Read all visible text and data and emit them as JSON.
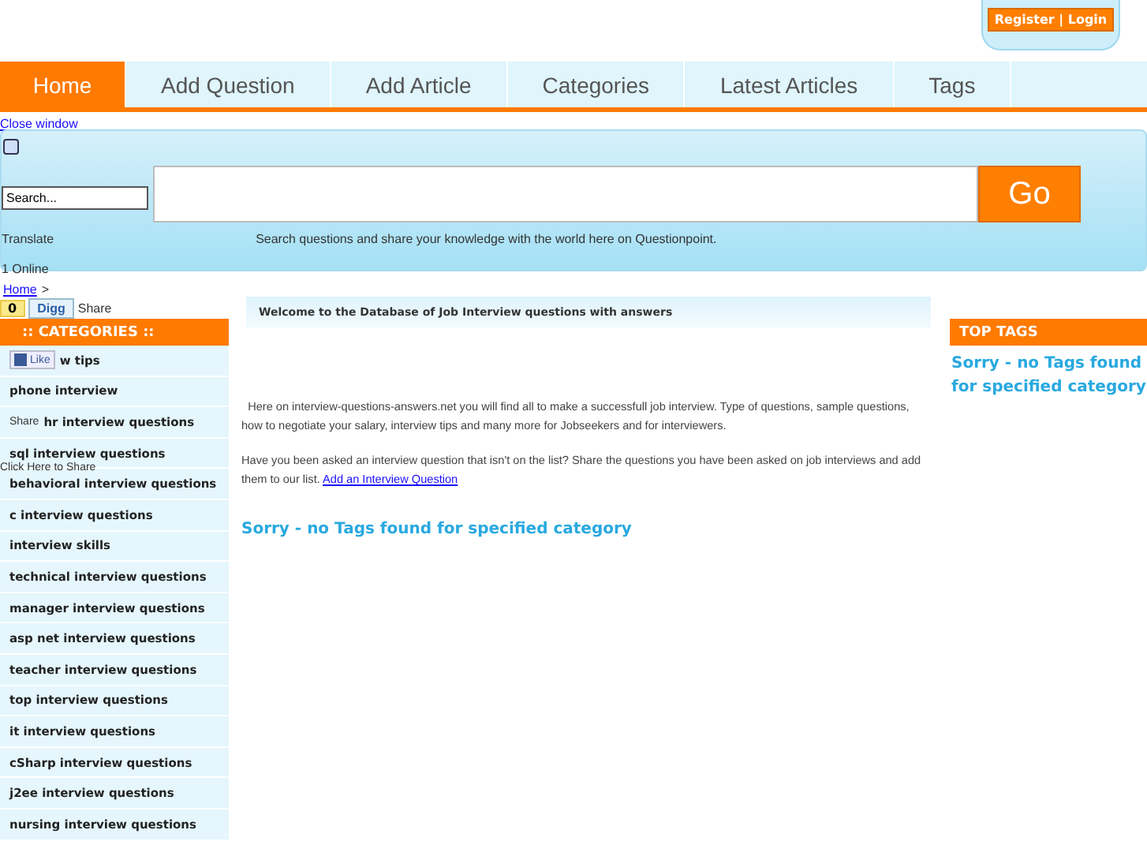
{
  "account": {
    "label": "Register | Login"
  },
  "nav": [
    {
      "label": "Home",
      "selected": true
    },
    {
      "label": "Add Question",
      "selected": false
    },
    {
      "label": "Add Article",
      "selected": false
    },
    {
      "label": "Categories",
      "selected": false
    },
    {
      "label": "Latest Articles",
      "selected": false
    },
    {
      "label": "Tags",
      "selected": false
    }
  ],
  "close_link": "Close window",
  "search": {
    "small_value": "Search...",
    "button": "Go",
    "translate": "Translate",
    "tagline": "Search questions and share your knowledge with the world here on Questionpoint.",
    "online": "1 Online"
  },
  "breadcrumb": {
    "link": "Home",
    "separator": ">"
  },
  "share": {
    "count": "0",
    "digg": "Digg",
    "share_label": "Share",
    "like": "Like",
    "share_label_2": "Share",
    "click_share": "Click Here to Share"
  },
  "categories": {
    "title": ":: CATEGORIES ::",
    "items": [
      "w tips",
      "phone interview",
      "hr interview questions",
      "sql interview questions",
      "behavioral interview questions",
      "c interview questions",
      "interview skills",
      "technical interview questions",
      "manager interview questions",
      "asp net interview questions",
      "teacher interview questions",
      "top interview questions",
      "it interview questions",
      "cSharp interview questions",
      "j2ee interview questions",
      "nursing interview questions"
    ]
  },
  "main": {
    "welcome": "Welcome to the Database of Job Interview questions with answers",
    "intro": "Here on interview-questions-answers.net you will find all to make a successfull job interview. Type of questions, sample questions, how to negotiate your salary, interview tips and many more for Jobseekers and for interviewers.",
    "ask": "Have you been asked an interview question that isn't on the list? Share the questions you have been asked on job interviews and add them to our list.",
    "ask_link": "Add an Interview Question",
    "notice": "Sorry - no Tags found for specified category"
  },
  "top_tags": {
    "title": "TOP TAGS",
    "notice": "Sorry - no Tags found for specified category"
  }
}
